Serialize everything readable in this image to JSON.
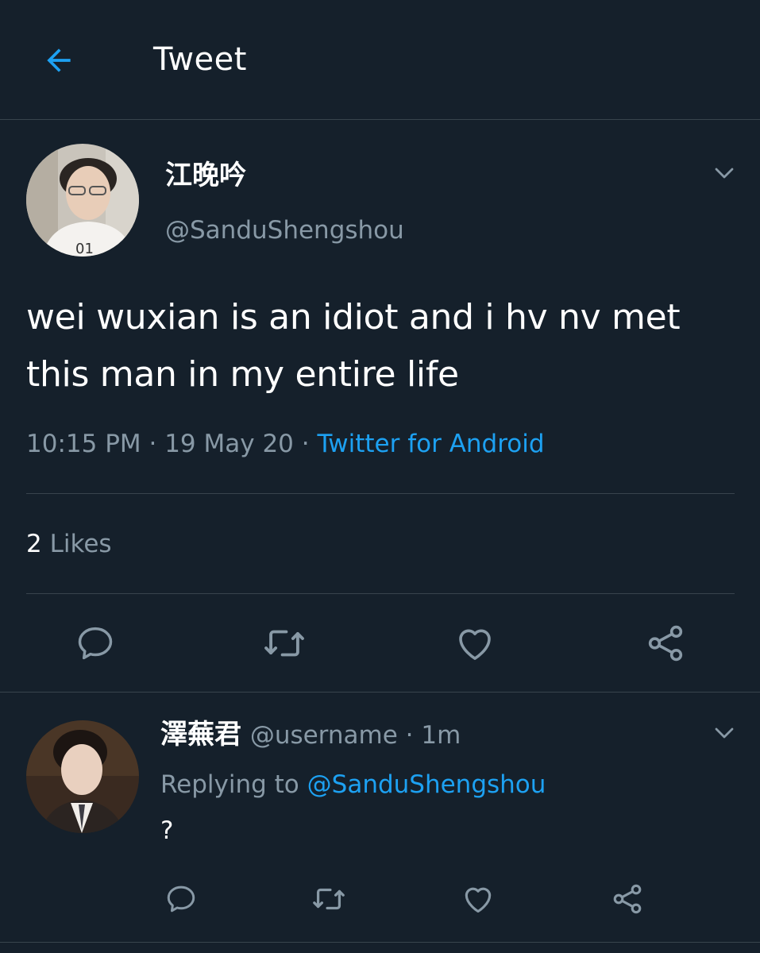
{
  "header": {
    "title": "Tweet",
    "back_icon": "arrow-left-icon",
    "accent": "#1da1f2"
  },
  "tweet": {
    "display_name": "江晚吟",
    "handle": "@SanduShengshou",
    "text": "wei wuxian is an idiot and i hv nv met this man in my entire life",
    "time": "10:15 PM",
    "date": "19 May 20",
    "separator": " · ",
    "source": "Twitter for Android",
    "likes_count": "2",
    "likes_label": "Likes",
    "actions": {
      "reply_icon": "reply-icon",
      "retweet_icon": "retweet-icon",
      "like_icon": "heart-icon",
      "share_icon": "share-icon"
    }
  },
  "reply": {
    "display_name": "澤蕪君",
    "handle": "@username",
    "time": "1m",
    "replying_prefix": "Replying to",
    "replying_to": "@SanduShengshou",
    "text": "?"
  },
  "colors": {
    "background": "#15202b",
    "border": "#38444d",
    "secondary_text": "#8899a6",
    "link": "#1da1f2",
    "primary_text": "#ffffff"
  }
}
